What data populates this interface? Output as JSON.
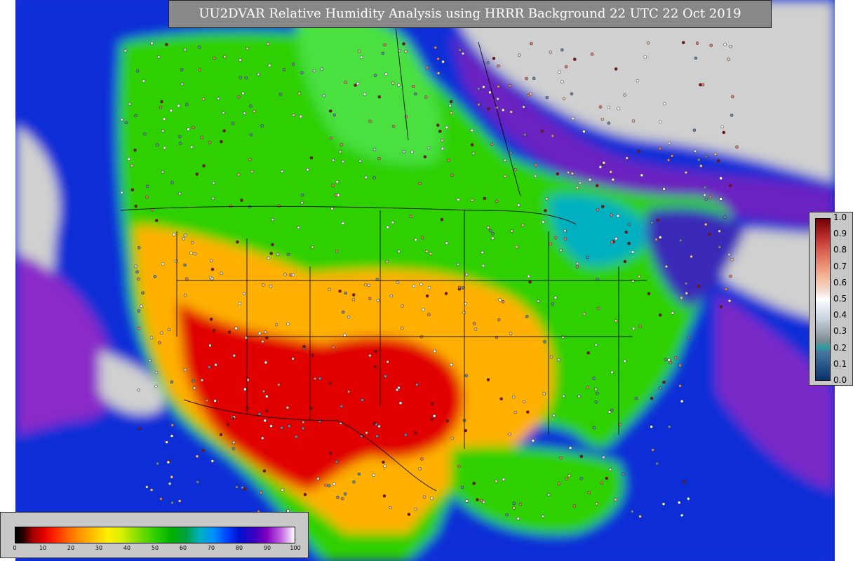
{
  "title": "UU2DVAR Relative Humidity Analysis using HRRR Background 22 UTC 22 Oct 2019",
  "bottom_colorbar": {
    "tick_labels": [
      "0",
      "10",
      "20",
      "30",
      "40",
      "50",
      "60",
      "70",
      "80",
      "90",
      "100"
    ],
    "range": [
      0,
      100
    ]
  },
  "side_colorbar": {
    "tick_labels": [
      "1.0",
      "0.9",
      "0.8",
      "0.7",
      "0.6",
      "0.5",
      "0.4",
      "0.3",
      "0.2",
      "0.1",
      "0.0"
    ],
    "range": [
      0.0,
      1.0
    ]
  },
  "colors": {
    "very_dry": "#e00000",
    "dry": "#ff8a00",
    "moderate": "#2ed000",
    "moist": "#0090ff",
    "very_moist": "#0010d0",
    "saturated": "#8000c0",
    "near_saturated": "#d0d0d0"
  }
}
